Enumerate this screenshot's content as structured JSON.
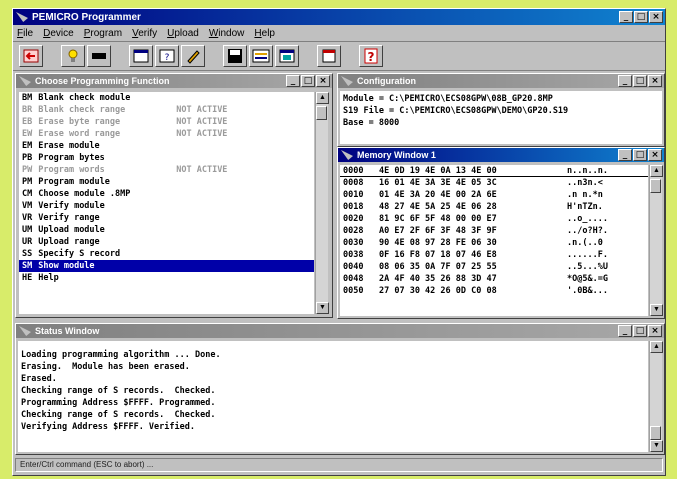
{
  "app": {
    "title": "PEMICRO Programmer"
  },
  "menu": [
    "File",
    "Device",
    "Program",
    "Verify",
    "Upload",
    "Window",
    "Help"
  ],
  "toolbar": [
    {
      "icon": "exit-arrow-icon"
    },
    {
      "icon": "bulb-icon"
    },
    {
      "icon": "chip-icon"
    },
    {
      "icon": "window-icon"
    },
    {
      "icon": "help-dialog-icon"
    },
    {
      "icon": "edit-icon"
    },
    {
      "icon": "save-icon"
    },
    {
      "icon": "record-icon"
    },
    {
      "icon": "reload-icon"
    },
    {
      "icon": "exit-door-icon"
    },
    {
      "icon": "question-icon"
    }
  ],
  "functions": {
    "title": "Choose Programming Function",
    "items": [
      {
        "code": "BM",
        "label": "Blank check module",
        "status": "",
        "dim": false
      },
      {
        "code": "BR",
        "label": "Blank check range",
        "status": "NOT ACTIVE",
        "dim": true
      },
      {
        "code": "EB",
        "label": "Erase byte range",
        "status": "NOT ACTIVE",
        "dim": true
      },
      {
        "code": "EW",
        "label": "Erase word range",
        "status": "NOT ACTIVE",
        "dim": true
      },
      {
        "code": "EM",
        "label": "Erase module",
        "status": "",
        "dim": false
      },
      {
        "code": "PB",
        "label": "Program bytes",
        "status": "",
        "dim": false
      },
      {
        "code": "PW",
        "label": "Program words",
        "status": "NOT ACTIVE",
        "dim": true
      },
      {
        "code": "PM",
        "label": "Program module",
        "status": "",
        "dim": false
      },
      {
        "code": "CM",
        "label": "Choose module .8MP",
        "status": "",
        "dim": false
      },
      {
        "code": "VM",
        "label": "Verify module",
        "status": "",
        "dim": false
      },
      {
        "code": "VR",
        "label": "Verify range",
        "status": "",
        "dim": false
      },
      {
        "code": "UM",
        "label": "Upload module",
        "status": "",
        "dim": false
      },
      {
        "code": "UR",
        "label": "Upload range",
        "status": "",
        "dim": false
      },
      {
        "code": "SS",
        "label": "Specify S record",
        "status": "",
        "dim": false
      },
      {
        "code": "SM",
        "label": "Show module",
        "status": "",
        "dim": false,
        "selected": true
      },
      {
        "code": "HE",
        "label": "Help",
        "status": "",
        "dim": false
      }
    ]
  },
  "config": {
    "title": "Configuration",
    "lines": [
      "Module = C:\\PEMICRO\\ECS08GPW\\08B_GP20.8MP",
      "S19 File = C:\\PEMICRO\\ECS08GPW\\DEMO\\GP20.S19",
      "Base = 8000"
    ]
  },
  "memory": {
    "title": "Memory Window 1",
    "rows": [
      {
        "addr": "0000",
        "bytes": "4E 0D 19 4E 0A 13 4E 00",
        "ascii": "n..n..n."
      },
      {
        "addr": "0008",
        "bytes": "16 01 4E 3A 3E 4E 05 3C",
        "ascii": "..n3n.<"
      },
      {
        "addr": "0010",
        "bytes": "01 4E 3A 20 4E 00 2A 6E",
        "ascii": ".n n.*n"
      },
      {
        "addr": "0018",
        "bytes": "48 27 4E 5A 25 4E 06 28",
        "ascii": "H'nTZn."
      },
      {
        "addr": "0020",
        "bytes": "81 9C 6F 5F 48 00 00 E7",
        "ascii": "..o_...."
      },
      {
        "addr": "0028",
        "bytes": "A0 E7 2F 6F 3F 48 3F 9F",
        "ascii": "../o?H?."
      },
      {
        "addr": "0030",
        "bytes": "90 4E 08 97 28 FE 06 30",
        "ascii": ".n.(..0"
      },
      {
        "addr": "0038",
        "bytes": "0F 16 F8 07 18 07 46 E8",
        "ascii": "......F."
      },
      {
        "addr": "0040",
        "bytes": "08 06 35 0A 7F 07 25 55",
        "ascii": "..5...%U"
      },
      {
        "addr": "0048",
        "bytes": "2A 4F 40 35 26 88 3D 47",
        "ascii": "*O@5&.=G"
      },
      {
        "addr": "0050",
        "bytes": "27 07 30 42 26 0D C0 08",
        "ascii": "'.0B&..."
      }
    ]
  },
  "status_window": {
    "title": "Status Window",
    "lines": [
      "Loading programming algorithm ... Done.",
      "Erasing.  Module has been erased.",
      "Erased.",
      "Checking range of S records.  Checked.",
      "Programming Address $FFFF. Programmed.",
      "Checking range of S records.  Checked.",
      "Verifying Address $FFFF. Verified."
    ]
  },
  "statusbar": {
    "text": "Enter/Ctrl command (ESC to abort) ..."
  },
  "colors": {
    "selection": "#0000a8",
    "active_title": "#000080",
    "background": "#d8ec6a"
  }
}
